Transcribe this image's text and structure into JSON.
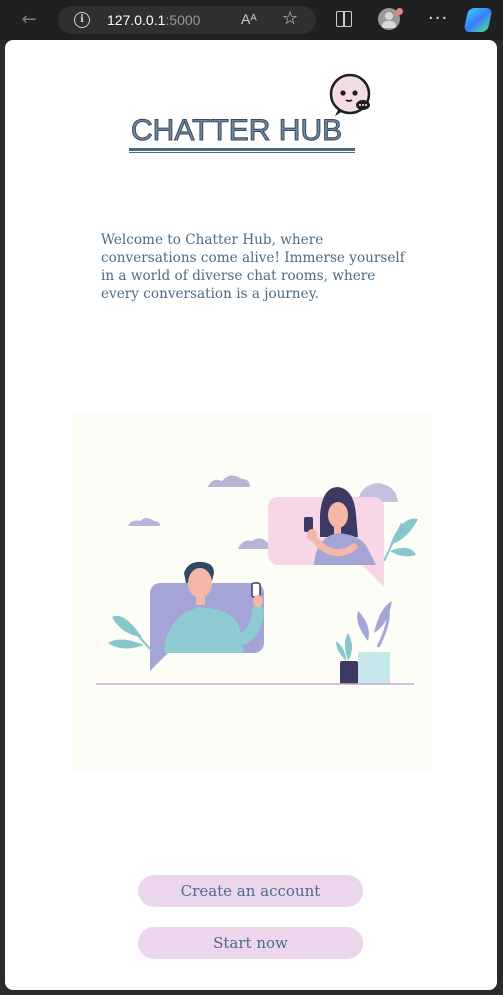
{
  "browser": {
    "url_host": "127.0.0.1",
    "url_port": ":5000",
    "read_aloud_label": "Aᴬ"
  },
  "app": {
    "logo_text": "CHATTER HUB",
    "welcome_text": "Welcome to Chatter Hub, where conversations come alive! Immerse yourself in a world of diverse chat rooms, where every conversation is a journey.",
    "buttons": {
      "create_account": "Create an account",
      "start_now": "Start now"
    }
  },
  "colors": {
    "primary_text": "#4d6b86",
    "button_bg": "#ecd6ec",
    "page_bg": "#ffffff",
    "chrome_bg": "#202020"
  },
  "icons": {
    "back": "back-arrow-icon",
    "info": "info-icon",
    "read_aloud": "read-aloud-icon",
    "favorite": "star-icon",
    "split": "split-screen-icon",
    "profile": "profile-icon",
    "more": "more-icon",
    "copilot": "copilot-icon",
    "logo": "chat-bubble-icon"
  }
}
